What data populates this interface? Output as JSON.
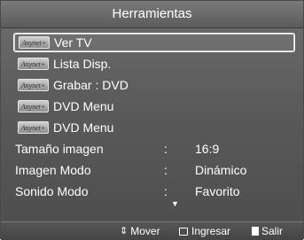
{
  "title": "Herramientas",
  "menu": [
    {
      "badge": "Anynet+",
      "label": "Ver TV"
    },
    {
      "badge": "Anynet+",
      "label": "Lista Disp."
    },
    {
      "badge": "Anynet+",
      "label": "Grabar : DVD"
    },
    {
      "badge": "Anynet+",
      "label": "DVD Menu"
    },
    {
      "badge": "Anynet+",
      "label": "DVD Menu"
    }
  ],
  "settings": [
    {
      "label": "Tamaño imagen",
      "colon": ":",
      "value": "16:9"
    },
    {
      "label": "Imagen Modo",
      "colon": ":",
      "value": "Dinámico"
    },
    {
      "label": "Sonido Modo",
      "colon": ":",
      "value": "Favorito"
    }
  ],
  "scroll_icon": "▼",
  "footer": {
    "move_icon": "⇕",
    "move_label": "Mover",
    "enter_label": "Ingresar",
    "exit_label": "Salir"
  },
  "colors": {
    "panel": "#5a5a5a",
    "text": "#ffffff"
  }
}
